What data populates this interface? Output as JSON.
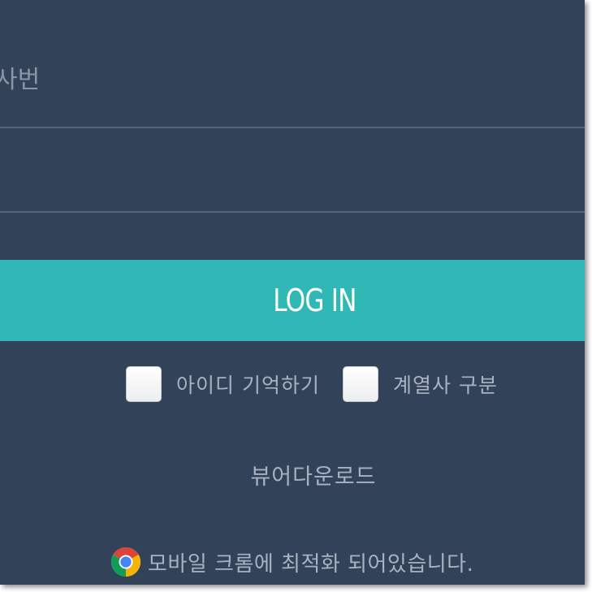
{
  "login": {
    "id_placeholder": "사번",
    "password_value": "",
    "login_label": "LOG IN"
  },
  "options": {
    "remember_id_label": "아이디 기억하기",
    "remember_id_checked": false,
    "affiliate_label": "계열사 구분",
    "affiliate_checked": false
  },
  "links": {
    "viewer_download": "뷰어다운로드"
  },
  "notice": {
    "icon": "chrome-icon",
    "text": "모바일 크롬에 최적화 되어있습니다."
  },
  "colors": {
    "background": "#314259",
    "accent": "#2fb8b5",
    "muted_text": "#a9b2c1",
    "divider": "#56647a"
  }
}
